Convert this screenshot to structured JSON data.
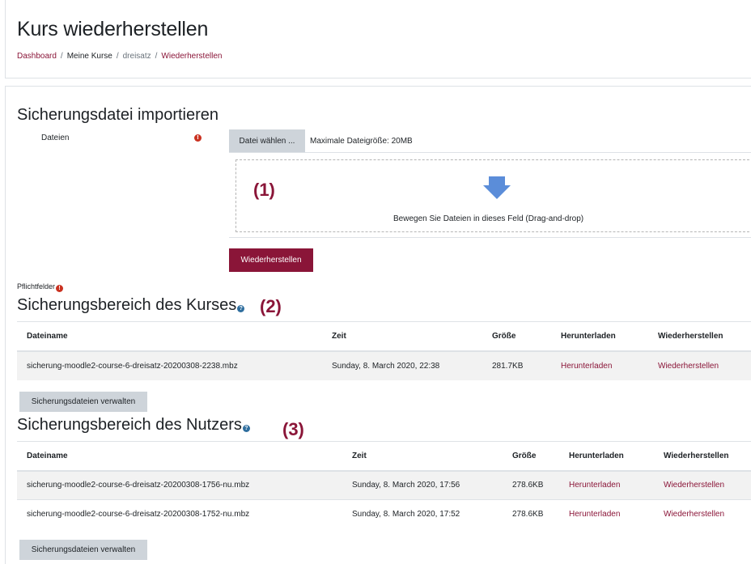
{
  "page": {
    "title": "Kurs wiederherstellen",
    "breadcrumb": [
      "Dashboard",
      "Meine Kurse",
      "dreisatz",
      "Wiederherstellen"
    ]
  },
  "import": {
    "title": "Sicherungsdatei importieren",
    "files_label": "Dateien",
    "choose_button": "Datei wählen ...",
    "max_size": "Maximale Dateigröße: 20MB",
    "drop_text": "Bewegen Sie Dateien in dieses Feld (Drag-and-drop)",
    "restore_button": "Wiederherstellen",
    "required_note": "Pflichtfelder",
    "required_icon": "exclamation-icon"
  },
  "annotations": [
    "(1)",
    "(2)",
    "(3)"
  ],
  "course_backup": {
    "title": "Sicherungsbereich des Kurses",
    "columns": [
      "Dateiname",
      "Zeit",
      "Größe",
      "Herunterladen",
      "Wiederherstellen"
    ],
    "rows": [
      {
        "filename": "sicherung-moodle2-course-6-dreisatz-20200308-2238.mbz",
        "time": "Sunday, 8. March 2020, 22:38",
        "size": "281.7KB",
        "download": "Herunterladen",
        "restore": "Wiederherstellen"
      }
    ],
    "manage_button": "Sicherungsdateien verwalten"
  },
  "user_backup": {
    "title": "Sicherungsbereich des Nutzers",
    "columns": [
      "Dateiname",
      "Zeit",
      "Größe",
      "Herunterladen",
      "Wiederherstellen"
    ],
    "rows": [
      {
        "filename": "sicherung-moodle2-course-6-dreisatz-20200308-1756-nu.mbz",
        "time": "Sunday, 8. March 2020, 17:56",
        "size": "278.6KB",
        "download": "Herunterladen",
        "restore": "Wiederherstellen"
      },
      {
        "filename": "sicherung-moodle2-course-6-dreisatz-20200308-1752-nu.mbz",
        "time": "Sunday, 8. March 2020, 17:52",
        "size": "278.6KB",
        "download": "Herunterladen",
        "restore": "Wiederherstellen"
      }
    ],
    "manage_button": "Sicherungsdateien verwalten"
  },
  "colors": {
    "brand": "#8a1538",
    "required": "#ca3120",
    "help": "#2f6e9e",
    "secondary_button": "#ced4da",
    "drop_arrow": "#5b8dd9"
  }
}
